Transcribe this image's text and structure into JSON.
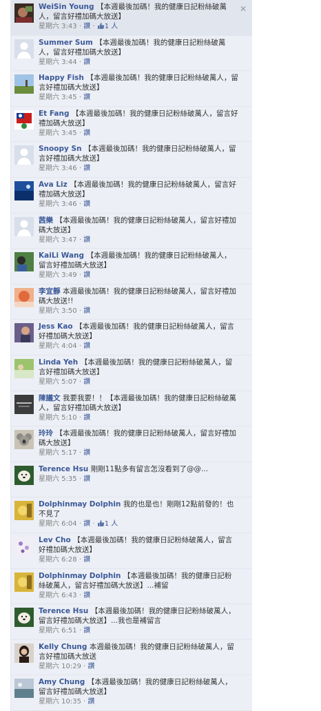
{
  "close_glyph": "✕",
  "like_icon": "thumbs-up-icon",
  "comments": [
    {
      "author": "WeiSin Young",
      "text": "【本週最後加碼！我的健康日記粉絲破萬人，留言好禮加碼大放送】",
      "time": "星期六 3:43",
      "like": "讚",
      "likes": "1 人",
      "avatar": "photo-dark",
      "highlight": true
    },
    {
      "author": "Summer Sum",
      "text": "【本週最後加碼！我的健康日記粉絲破萬人，留言好禮加碼大放送】",
      "time": "星期六 3:44",
      "like": "讚",
      "avatar": "silhouette"
    },
    {
      "author": "Happy Fish",
      "text": "【本週最後加碼！我的健康日記粉絲破萬人，留言好禮加碼大放送】",
      "time": "星期六 3:45",
      "like": "讚",
      "avatar": "landscape"
    },
    {
      "author": "Et Fang",
      "text": "【本週最後加碼！我的健康日記粉絲破萬人，留言好禮加碼大放送】",
      "time": "星期六 3:45",
      "like": "讚",
      "avatar": "flag"
    },
    {
      "author": "Snoopy Sn",
      "text": "【本週最後加碼！我的健康日記粉絲破萬人，留言好禮加碼大放送】",
      "time": "星期六 3:46",
      "like": "讚",
      "avatar": "silhouette"
    },
    {
      "author": "Ava Liz",
      "text": "【本週最後加碼！我的健康日記粉絲破萬人，留言好禮加碼大放送】",
      "time": "星期六 3:46",
      "like": "讚",
      "avatar": "ocean"
    },
    {
      "author": "茜樂",
      "text": "【本週最後加碼！我的健康日記粉絲破萬人，留言好禮加碼大放送】",
      "time": "星期六 3:47",
      "like": "讚",
      "avatar": "silhouette"
    },
    {
      "author": "KaiLi Wang",
      "text": "【本週最後加碼！我的健康日記粉絲破萬人，留言好禮加碼大放送】",
      "time": "星期六 3:49",
      "like": "讚",
      "avatar": "person-green"
    },
    {
      "author": "李宜靜",
      "text": "本週最後加碼！我的健康日記粉絲破萬人，留言好禮加碼大放送!!",
      "time": "星期六 3:50",
      "like": "讚",
      "avatar": "orange"
    },
    {
      "author": "Jess Kao",
      "text": "【本週最後加碼！我的健康日記粉絲破萬人，留言好禮加碼大放送】",
      "time": "星期六 4:04",
      "like": "讚",
      "avatar": "person-dark"
    },
    {
      "author": "Linda Yeh",
      "text": "【本週最後加碼！我的健康日記粉絲破萬人，留言好禮加碼大放送】",
      "time": "星期六 5:07",
      "like": "讚",
      "avatar": "outdoor"
    },
    {
      "author": "陳議文",
      "text": "我要我要！！【本週最後加碼！我的健康日記粉絲破萬人，留言好禮加碼大放送】",
      "time": "星期六 5:10",
      "like": "讚",
      "avatar": "logo-dark",
      "avatar_text": "OMLIGHT 歐.米人"
    },
    {
      "author": "玲玲",
      "text": "【本週最後加碼！我的健康日記粉絲破萬人，留言好禮加碼大放送】",
      "time": "星期六 5:17",
      "like": "讚",
      "avatar": "koala"
    },
    {
      "author": "Terence Hsu",
      "text": "剛剛11點多有留言怎沒看到了@@...",
      "time": "星期六 5:35",
      "like": "讚",
      "avatar": "dog"
    },
    {
      "author": "Dolphinmay Dolphin",
      "text": "我的也是也！剛剛12點前發的！也不見了",
      "time": "星期六 6:04",
      "like": "讚",
      "likes": "1 人",
      "avatar": "yellow"
    },
    {
      "author": "Lev Cho",
      "text": "【本週最後加碼！我的健康日記粉絲破萬人，留言好禮加碼大放送】",
      "time": "星期六 6:28",
      "like": "讚",
      "avatar": "flowers"
    },
    {
      "author": "Dolphinmay Dolphin",
      "text": "【本週最後加碼！我的健康日記粉絲破萬人，留言好禮加碼大放送】...補留",
      "time": "星期六 6:43",
      "like": "讚",
      "avatar": "yellow"
    },
    {
      "author": "Terence Hsu",
      "text": "【本週最後加碼！我的健康日記粉絲破萬人，留言好禮加碼大放送】...我也是補留言",
      "time": "星期六 6:51",
      "like": "讚",
      "avatar": "dog"
    },
    {
      "author": "Kelly Chung",
      "text": "本週最後加碼！我的健康日記粉絲破萬人，留言好禮加碼大放送",
      "time": "星期六 10:29",
      "like": "讚",
      "avatar": "woman"
    },
    {
      "author": "Amy Chung",
      "text": "【本週最後加碼！我的健康日記粉絲破萬人，留言好禮加碼大放送】",
      "time": "星期六 10:35",
      "like": "讚",
      "avatar": "scenery"
    }
  ]
}
